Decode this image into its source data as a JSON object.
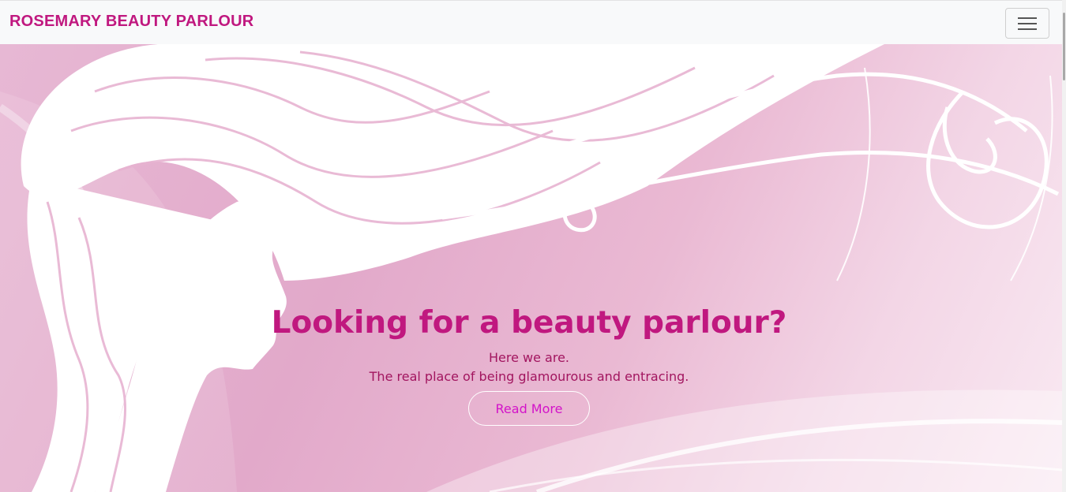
{
  "navbar": {
    "brand": "ROSEMARY BEAUTY PARLOUR",
    "menu_icon": "hamburger-menu-icon"
  },
  "hero": {
    "headline": "Looking for a beauty parlour?",
    "line1": "Here we are.",
    "line2": "The real place of being glamourous and entracing.",
    "button_label": "Read More"
  },
  "colors": {
    "brand": "#c0187f",
    "button_text": "#d313c9",
    "navbar_bg": "#f8f9fa",
    "hero_pink": "#e2a9ca"
  }
}
